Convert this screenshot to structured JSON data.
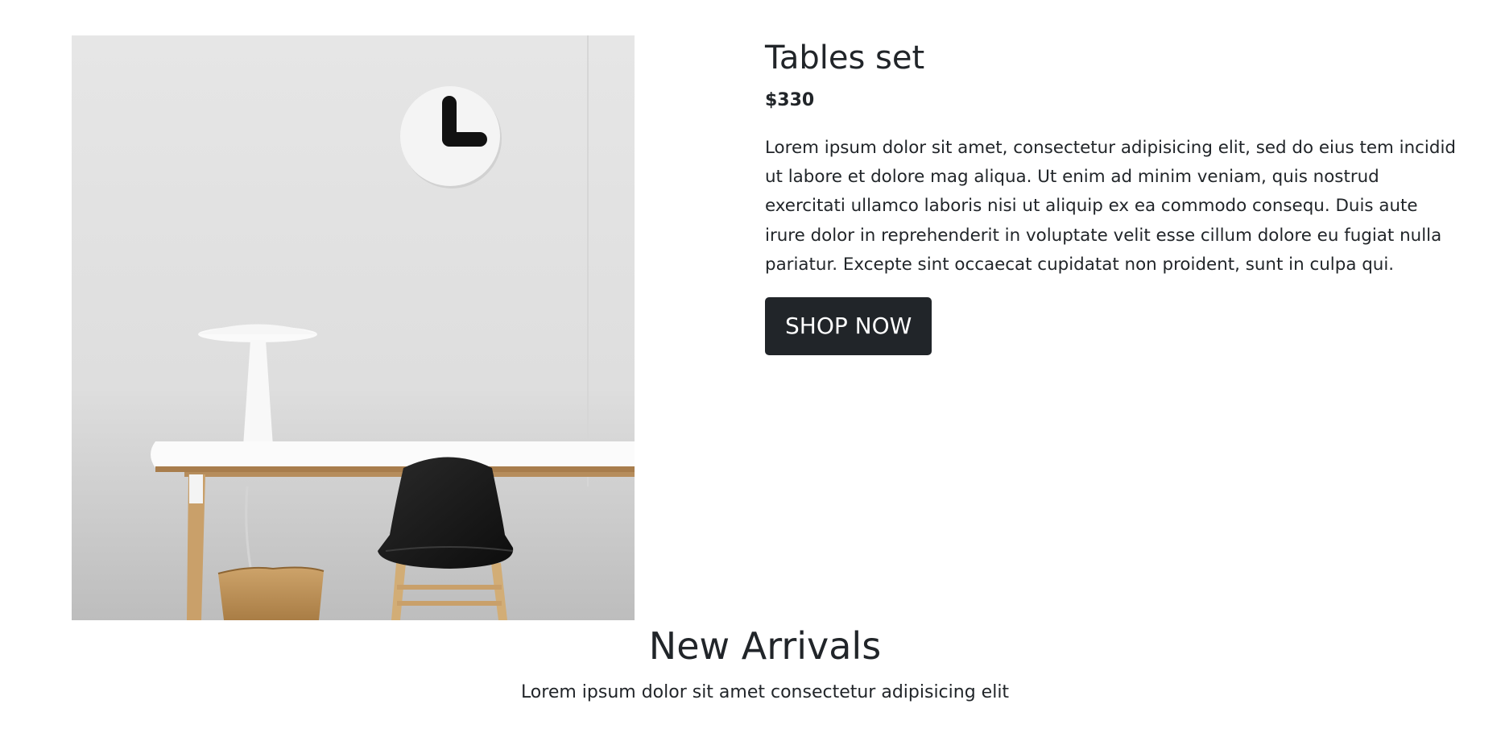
{
  "product": {
    "title": "Tables set",
    "price": "$330",
    "description": "Lorem ipsum dolor sit amet, consectetur adipisicing elit, sed do eius tem incidid ut labore et dolore mag aliqua. Ut enim ad minim veniam, quis nostrud exercitati ullamco laboris nisi ut aliquip ex ea commodo consequ. Duis aute irure dolor in reprehenderit in voluptate velit esse cillum dolore eu fugiat nulla pariatur. Excepte sint occaecat cupidatat non proident, sunt in culpa qui.",
    "button_label": "SHOP NOW",
    "button_color": "#212529"
  },
  "section": {
    "title": "New Arrivals",
    "subtitle": "Lorem ipsum dolor sit amet consectetur adipisicing elit"
  }
}
